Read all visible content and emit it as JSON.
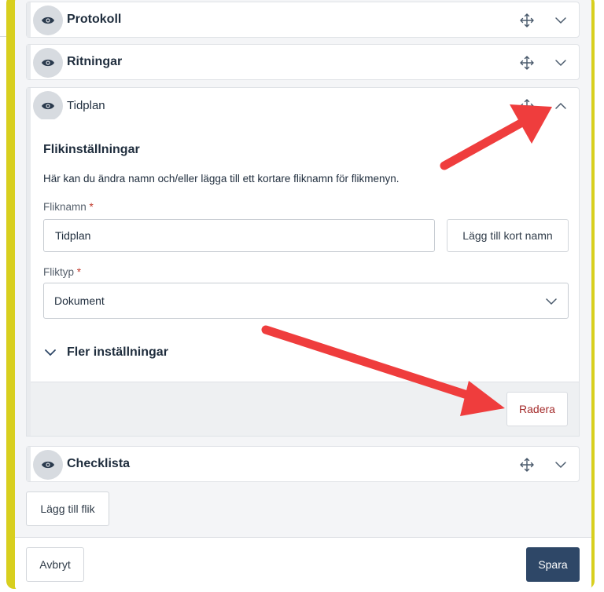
{
  "colors": {
    "frame_highlight": "#d8cf1e",
    "annotation_arrow": "#ef3d3d",
    "primary_button": "#2e4767",
    "delete_text": "#a42b2b",
    "required_mark": "#c0392b"
  },
  "tabs": [
    {
      "title": "Protokoll",
      "expanded": false,
      "icons": [
        "eye-icon",
        "move-icon",
        "chevron-down-icon"
      ]
    },
    {
      "title": "Ritningar",
      "expanded": false,
      "icons": [
        "eye-icon",
        "move-icon",
        "chevron-down-icon"
      ]
    },
    {
      "title": "Tidplan",
      "expanded": true,
      "icons": [
        "eye-icon",
        "move-icon",
        "chevron-up-icon"
      ]
    },
    {
      "title": "Checklista",
      "expanded": false,
      "icons": [
        "eye-icon",
        "move-icon",
        "chevron-down-icon"
      ]
    }
  ],
  "settings": {
    "title": "Flikinställningar",
    "description": "Här kan du ändra namn och/eller lägga till ett kortare fliknamn för flikmenyn.",
    "name_label": "Fliknamn",
    "type_label": "Fliktyp",
    "required_mark": "*",
    "name_value": "Tidplan",
    "add_short_name_label": "Lägg till kort namn",
    "type_value": "Dokument",
    "more_settings_label": "Fler inställningar",
    "delete_label": "Radera"
  },
  "actions": {
    "add_tab_label": "Lägg till flik",
    "cancel_label": "Avbryt",
    "save_label": "Spara"
  }
}
